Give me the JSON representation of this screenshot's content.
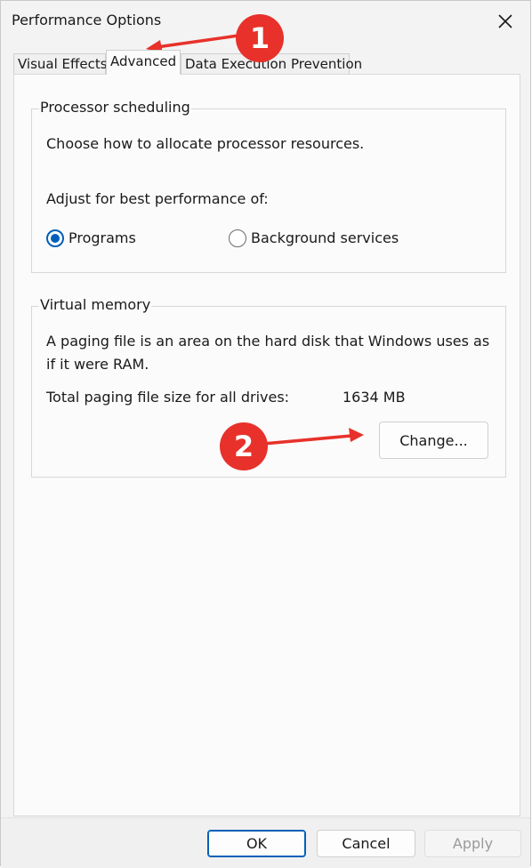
{
  "window": {
    "title": "Performance Options"
  },
  "tabs": [
    {
      "label": "Visual Effects",
      "active": false
    },
    {
      "label": "Advanced",
      "active": true
    },
    {
      "label": "Data Execution Prevention",
      "active": false
    }
  ],
  "processor": {
    "group_label": "Processor scheduling",
    "description": "Choose how to allocate processor resources.",
    "adjust_label": "Adjust for best performance of:",
    "options": [
      {
        "label": "Programs",
        "selected": true
      },
      {
        "label": "Background services",
        "selected": false
      }
    ]
  },
  "virtual_memory": {
    "group_label": "Virtual memory",
    "description_line1": "A paging file is an area on the hard disk that Windows uses as",
    "description_line2": "if it were RAM.",
    "total_label": "Total paging file size for all drives:",
    "total_value": "1634 MB",
    "change_button": "Change..."
  },
  "footer": {
    "ok": "OK",
    "cancel": "Cancel",
    "apply": "Apply"
  },
  "annotations": [
    {
      "number": "1"
    },
    {
      "number": "2"
    }
  ],
  "colors": {
    "accent": "#005fb8",
    "annotation": "#e8312a"
  },
  "icons": {
    "close": "close-icon"
  }
}
